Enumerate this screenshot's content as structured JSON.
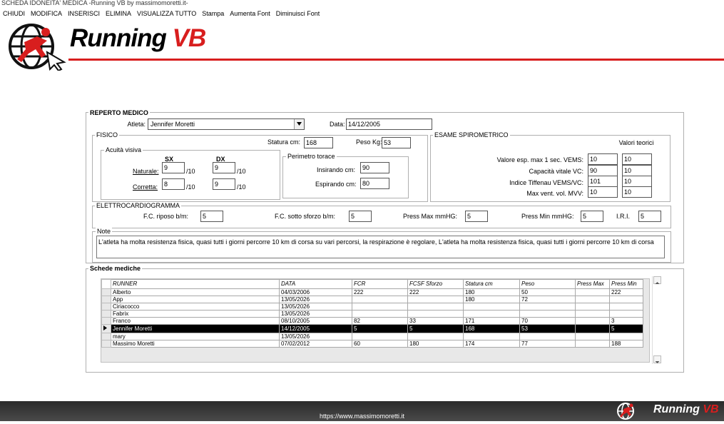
{
  "window": {
    "title": "SCHEDA IDONEITA' MEDICA  -Running VB by massimomoretti.it-"
  },
  "menu": [
    "CHIUDI",
    "MODIFICA",
    "INSERISCI",
    "ELIMINA",
    "VISUALIZZA TUTTO",
    "Stampa",
    "Aumenta Font",
    "Diminuisci Font"
  ],
  "brand": {
    "name": "Running",
    "suffix": "VB",
    "accent": "#d81e1e"
  },
  "reperto": {
    "title": "REPERTO MEDICO",
    "atleta_label": "Atleta:",
    "atleta_value": "Jennifer Moretti",
    "data_label": "Data:",
    "data_value": "14/12/2005"
  },
  "fisico": {
    "title": "FISICO",
    "statura_label": "Statura cm:",
    "statura_value": "168",
    "peso_label": "Peso Kg:",
    "peso_value": "53",
    "acuita": {
      "title": "Acuità visiva",
      "sx_label": "SX",
      "dx_label": "DX",
      "naturale_label": "Naturale:",
      "corretta_label": "Corretta:",
      "naturale_sx": "9",
      "naturale_dx": "9",
      "corretta_sx": "8",
      "corretta_dx": "9",
      "unit": "/10"
    },
    "perimetro": {
      "title": "Perimetro torace",
      "insirando_label": "Insirando cm:",
      "insirando_value": "90",
      "espirando_label": "Espirando cm:",
      "espirando_value": "80"
    }
  },
  "spiro": {
    "title": "ESAME SPIROMETRICO",
    "valori_label": "Valori teorici",
    "rows": [
      {
        "label": "Valore esp. max 1 sec. VEMS:",
        "value": "10",
        "teorico": "10"
      },
      {
        "label": "Capacità vitale VC:",
        "value": "90",
        "teorico": "10"
      },
      {
        "label": "Indice Tiffenau VEMS/VC:",
        "value": "101",
        "teorico": "10"
      },
      {
        "label": "Max vent. vol. MVV:",
        "value": "10",
        "teorico": "10"
      }
    ]
  },
  "ecg": {
    "title": "ELETTROCARDIOGRAMMA",
    "riposo_label": "F.C. riposo b/m:",
    "riposo_value": "5",
    "sforzo_label": "F.C. sotto sforzo b/m:",
    "sforzo_value": "5",
    "pmax_label": "Press Max mmHG:",
    "pmax_value": "5",
    "pmin_label": "Press Min mmHG:",
    "pmin_value": "5",
    "iri_label": "I.R.I.",
    "iri_value": "5"
  },
  "note": {
    "title": "Note",
    "value": "L'atleta ha molta resistenza fisica, quasi tutti i giorni percorre 10 km di corsa su vari percorsi, la respirazione è regolare, L'atleta ha molta resistenza fisica, quasi tutti i giorni percorre 10 km di corsa"
  },
  "schede": {
    "title": "Schede mediche",
    "columns": [
      "RUNNER",
      "DATA",
      "FCR",
      "FCSF Sforzo",
      "Statura cm",
      "Peso",
      "Press Max",
      "Press Min"
    ],
    "rows": [
      [
        "Alberto",
        "04/03/2006",
        "222",
        "222",
        "180",
        "50",
        "",
        "222"
      ],
      [
        "App",
        "13/05/2026",
        "",
        "",
        "180",
        "72",
        "",
        ""
      ],
      [
        "Ciriacocco",
        "13/05/2026",
        "",
        "",
        "",
        "",
        "",
        ""
      ],
      [
        "Fabrix",
        "13/05/2026",
        "",
        "",
        "",
        "",
        "",
        ""
      ],
      [
        "Franco",
        "08/10/2005",
        "82",
        "33",
        "171",
        "70",
        "",
        "3"
      ],
      [
        "Jennifer Moretti",
        "14/12/2005",
        "5",
        "5",
        "168",
        "53",
        "",
        "5"
      ],
      [
        "mary",
        "13/05/2026",
        "",
        "",
        "",
        "",
        "",
        ""
      ],
      [
        "Massimo Moretti",
        "07/02/2012",
        "60",
        "180",
        "174",
        "77",
        "",
        "188"
      ]
    ],
    "selected_index": 5
  },
  "footer": {
    "url": "https://www.massimomoretti.it"
  }
}
